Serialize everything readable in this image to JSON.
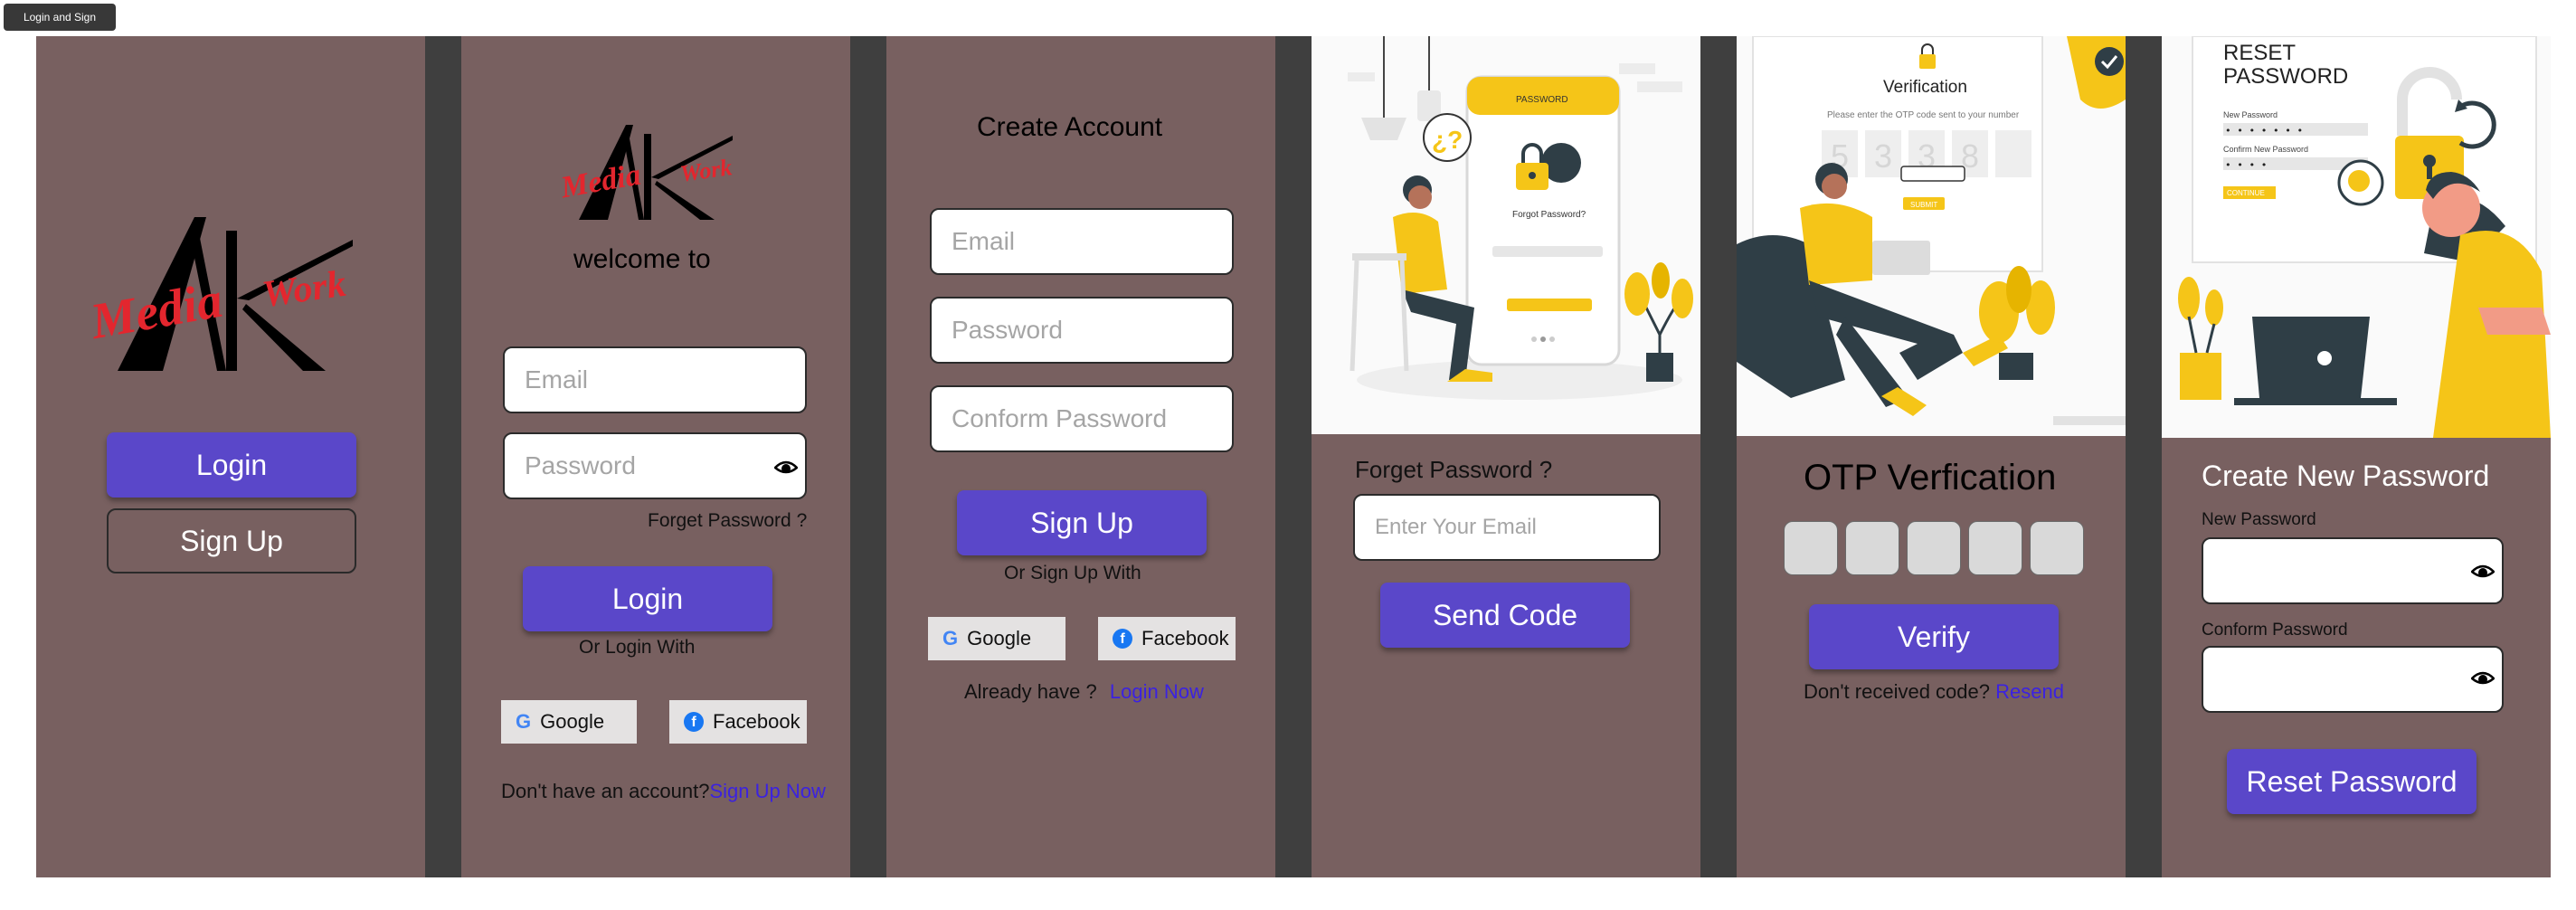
{
  "frame_label": "Login and Sign",
  "logo": {
    "lines": [
      "Media",
      "Work"
    ]
  },
  "screen1": {
    "login_label": "Login",
    "signup_label": "Sign Up"
  },
  "screen2": {
    "welcome": "welcome to",
    "email_placeholder": "Email",
    "password_placeholder": "Password",
    "forget_link": "Forget Password ?",
    "login_label": "Login",
    "or_login_with": "Or Login With",
    "google": "Google",
    "facebook": "Facebook",
    "no_account": "Don't have an account?",
    "signup_now": "Sign Up Now"
  },
  "screen3": {
    "title": "Create Account",
    "email_placeholder": "Email",
    "password_placeholder": "Password",
    "confirm_placeholder": "Conform Password",
    "signup_label": "Sign Up",
    "or_signup_with": "Or Sign Up  With",
    "google": "Google",
    "facebook": "Facebook",
    "already": "Already have ?",
    "login_now": "Login Now"
  },
  "screen4": {
    "title": "Forget Password ?",
    "email_placeholder": "Enter Your Email",
    "send_label": "Send Code",
    "illus_header": "PASSWORD",
    "illus_caption": "Forgot Password?",
    "illus_question": "¿?"
  },
  "screen5": {
    "title": "OTP Verfication",
    "verify_label": "Verify",
    "not_received": "Don't received code?",
    "resend": "Resend",
    "illus_title": "Verification",
    "illus_sub": "Please enter the OTP code sent to your number",
    "illus_digits": [
      "5",
      "3",
      "3",
      "8"
    ],
    "illus_submit": "SUBMIT"
  },
  "screen6": {
    "title": "Create New Password",
    "new_label": "New Password",
    "confirm_label": "Conform  Password",
    "reset_label": "Reset Password",
    "illus_title_1": "RESET",
    "illus_title_2": "PASSWORD",
    "illus_new": "New Password",
    "illus_confirm": "Confirm New Password",
    "illus_continue": "CONTINUE"
  },
  "colors": {
    "screen_bg": "#786060",
    "primary": "#5a47c9",
    "link": "#3b22e0",
    "logo_red": "#e3262e",
    "accent_yellow": "#f5c518"
  }
}
